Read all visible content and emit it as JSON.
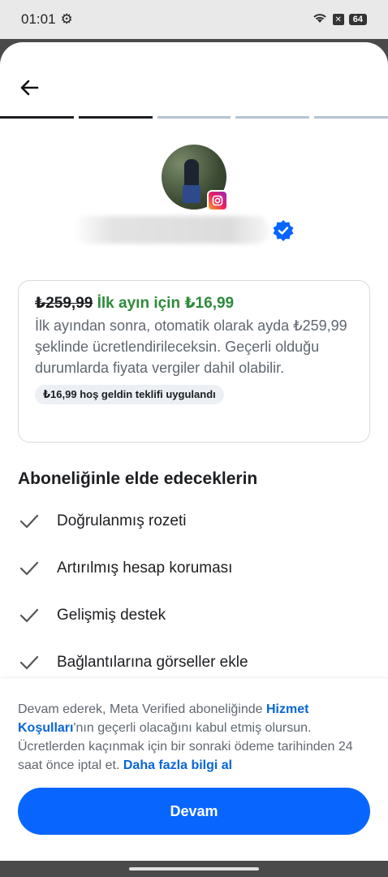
{
  "status_bar": {
    "time": "01:01",
    "battery": "64"
  },
  "profile": {
    "platform": "instagram-icon",
    "verified": true
  },
  "offer": {
    "old_price": "₺259,99",
    "promo_text": "İlk ayın için ₺16,99",
    "description": "İlk ayından sonra, otomatik olarak ayda ₺259,99 şeklinde ücretlendirileceksin. Geçerli olduğu durumlarda fiyata vergiler dahil olabilir.",
    "chip": "₺16,99 hoş geldin teklifi uygulandı"
  },
  "benefits": {
    "title": "Aboneliğinle elde edeceklerin",
    "items": [
      "Doğrulanmış rozeti",
      "Artırılmış hesap koruması",
      "Gelişmiş destek",
      "Bağlantılarına görseller ekle"
    ]
  },
  "legal": {
    "part1": "Devam ederek, Meta Verified aboneliğinde ",
    "link1": "Hizmet Koşulları",
    "part2": "'nın geçerli olacağını kabul etmiş olursun. Ücretlerden kaçınmak için bir sonraki ödeme tarihinden 24 saat önce iptal et. ",
    "link2": "Daha fazla bilgi al"
  },
  "cta_label": "Devam",
  "colors": {
    "primary": "#0866ff",
    "promo": "#2e8b3a",
    "link": "#0866d6"
  }
}
